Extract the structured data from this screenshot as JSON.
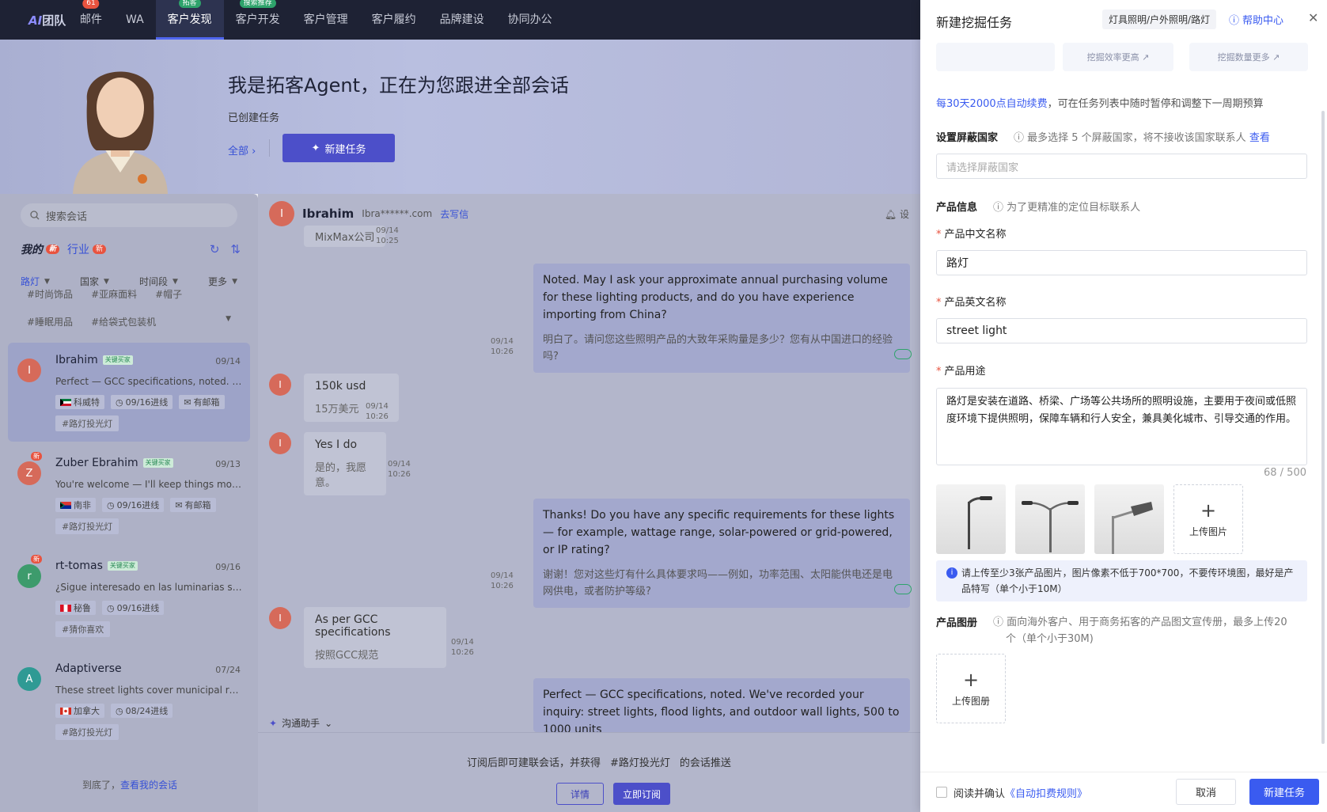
{
  "nav": {
    "brand_ai": "AI",
    "brand_text": "团队",
    "items": [
      {
        "label": "邮件",
        "badge": "61"
      },
      {
        "label": "WA"
      },
      {
        "label": "客户发现",
        "tag": "拓客",
        "active": true
      },
      {
        "label": "客户开发",
        "tag": "搜索推荐"
      },
      {
        "label": "客户管理"
      },
      {
        "label": "客户履约"
      },
      {
        "label": "品牌建设"
      },
      {
        "label": "协同办公"
      }
    ]
  },
  "hero": {
    "title": "我是拓客Agent，正在为您跟进全部会话",
    "subtitle": "已创建任务",
    "all_link": "全部 ›",
    "new_task": "新建任务"
  },
  "left": {
    "search_placeholder": "搜索会话",
    "tab_mine": "我的",
    "tab_industry": "行业",
    "badge_new": "新",
    "filters": [
      "路灯",
      "国家",
      "时间段",
      "更多"
    ],
    "tags_row1": [
      "#时尚饰品",
      "#亚麻面料",
      "#帽子"
    ],
    "tags_row2": [
      "#睡眠用品",
      "#给袋式包装机"
    ],
    "sessions": [
      {
        "initial": "I",
        "name": "Ibrahim",
        "key": "关键买家",
        "date": "09/14",
        "preview": "Perfect — GCC specifications, noted. W...",
        "country": "科威特",
        "follow": "09/16进线",
        "mail": "有邮箱",
        "tag": "#路灯投光灯"
      },
      {
        "initial": "Z",
        "name": "Zuber Ebrahim",
        "key": "关键买家",
        "date": "09/13",
        "preview": "You're welcome — I'll keep things movi...",
        "country": "南非",
        "follow": "09/16进线",
        "mail": "有邮箱",
        "tag": "#路灯投光灯",
        "new": "新"
      },
      {
        "initial": "r",
        "name": "rt-tomas",
        "key": "关键买家",
        "date": "09/16",
        "preview": "¿Sigue interesado en las luminarias sol...",
        "country": "秘鲁",
        "follow": "09/16进线",
        "tag": "#猜你喜欢",
        "new": "新"
      },
      {
        "initial": "A",
        "name": "Adaptiverse",
        "date": "07/24",
        "preview": "These street lights cover municipal roa...",
        "country": "加拿大",
        "follow": "08/24进线",
        "tag": "#路灯投光灯"
      }
    ],
    "end_text": "到底了，",
    "end_link": "查看我的会话"
  },
  "chat": {
    "initial": "I",
    "name": "Ibrahim",
    "email": "Ibra******.com",
    "write": "去写信",
    "settings": "设",
    "msg0": {
      "text": "MixMax公司",
      "time": "09/14\n10:25"
    },
    "msg1": {
      "en": "Noted. May I ask your approximate annual purchasing volume for these lighting products, and do you have experience importing from China?",
      "zh": "明白了。请问您这些照明产品的大致年采购量是多少？您有从中国进口的经验吗?",
      "time": "09/14\n10:26"
    },
    "msg2": {
      "en": "150k usd",
      "zh": "15万美元",
      "time": "09/14\n10:26"
    },
    "msg3": {
      "en": "Yes I do",
      "zh": "是的，我愿意。",
      "time": "09/14\n10:26"
    },
    "msg4": {
      "en": "Thanks! Do you have any specific requirements for these lights — for example, wattage range, solar-powered or grid-powered, or IP rating?",
      "zh": "谢谢！您对这些灯有什么具体要求吗——例如，功率范围、太阳能供电还是电网供电，或者防护等级?",
      "time": "09/14\n10:26"
    },
    "msg5": {
      "en": "As per GCC specifications",
      "zh": "按照GCC规范",
      "time": "09/14\n10:26"
    },
    "msg6": {
      "en": "Perfect — GCC specifications, noted. We've recorded your inquiry: street lights, flood lights, and outdoor wall lights, 500 to 1000 units"
    },
    "assistant": "沟通助手",
    "sub_text_a": "订阅后即可建联会话，并获得",
    "sub_tag": "#路灯投光灯",
    "sub_text_b": "的会话推送",
    "btn_detail": "详情",
    "btn_subscribe": "立即订阅"
  },
  "drawer": {
    "title": "新建挖掘任务",
    "category": "灯具照明/户外照明/路灯",
    "help": "帮助中心",
    "plan_cards": [
      "",
      "挖掘效率更高 ↗",
      "挖掘数量更多 ↗"
    ],
    "renew_hl": "每30天2000点自动续费",
    "renew_rest": "，可在任务列表中随时暂停和调整下一周期预算",
    "block_label": "设置屏蔽国家",
    "block_hint": "最多选择 5 个屏蔽国家，将不接收该国家联系人",
    "block_link": "查看",
    "block_placeholder": "请选择屏蔽国家",
    "product_label": "产品信息",
    "product_hint": "为了更精准的定位目标联系人",
    "cn_name_label": "产品中文名称",
    "cn_name_value": "路灯",
    "en_name_label": "产品英文名称",
    "en_name_value": "street light",
    "usage_label": "产品用途",
    "usage_value": "路灯是安装在道路、桥梁、广场等公共场所的照明设施，主要用于夜间或低照度环境下提供照明，保障车辆和行人安全，兼具美化城市、引导交通的作用。",
    "counter": "68 / 500",
    "upload_image": "上传图片",
    "notice": "请上传至少3张产品图片，图片像素不低于700*700，不要传环境图，最好是产品特写（单个小于10M）",
    "brochure_label": "产品图册",
    "brochure_hint_a": "面向海外客户、用于商务拓客的产品图文宣传册，最多上传20",
    "brochure_hint_b": "个（单个小于30M)",
    "upload_brochure": "上传图册",
    "agree_text": "阅读并确认",
    "agree_link": "《自动扣费规则》",
    "cancel": "取消",
    "create": "新建任务"
  }
}
